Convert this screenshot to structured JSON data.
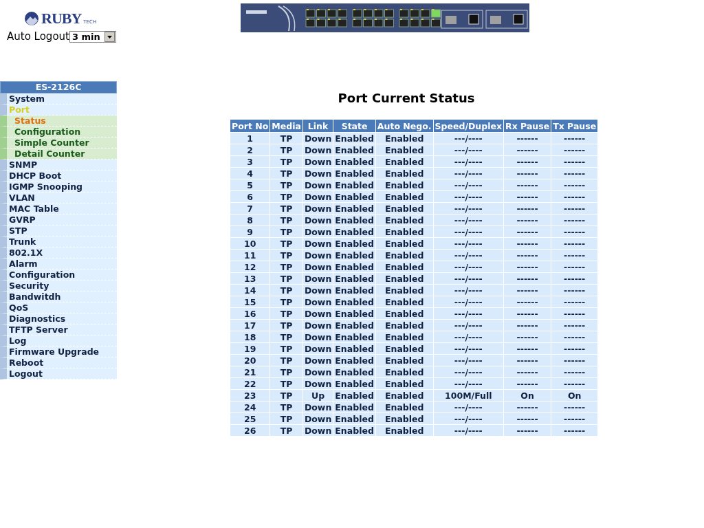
{
  "logo": {
    "text": "RUBY",
    "suffix": "TECH"
  },
  "auto_logout": {
    "label": "Auto Logout",
    "value": "3 min"
  },
  "sidebar": {
    "title": "ES-2126C",
    "items": [
      {
        "label": "System",
        "selected": false,
        "expanded": false
      },
      {
        "label": "Port",
        "selected": false,
        "expanded": true,
        "children": [
          {
            "label": "Status",
            "selected": true
          },
          {
            "label": "Configuration",
            "selected": false
          },
          {
            "label": "Simple Counter",
            "selected": false
          },
          {
            "label": "Detail Counter",
            "selected": false
          }
        ]
      },
      {
        "label": "SNMP",
        "selected": false,
        "expanded": false
      },
      {
        "label": "DHCP Boot",
        "selected": false,
        "expanded": false
      },
      {
        "label": "IGMP Snooping",
        "selected": false,
        "expanded": false
      },
      {
        "label": "VLAN",
        "selected": false,
        "expanded": false
      },
      {
        "label": "MAC Table",
        "selected": false,
        "expanded": false
      },
      {
        "label": "GVRP",
        "selected": false,
        "expanded": false
      },
      {
        "label": "STP",
        "selected": false,
        "expanded": false
      },
      {
        "label": "Trunk",
        "selected": false,
        "expanded": false
      },
      {
        "label": "802.1X",
        "selected": false,
        "expanded": false
      },
      {
        "label": "Alarm",
        "selected": false,
        "expanded": false
      },
      {
        "label": "Configuration",
        "selected": false,
        "expanded": false
      },
      {
        "label": "Security",
        "selected": false,
        "expanded": false
      },
      {
        "label": "Bandwitdh",
        "selected": false,
        "expanded": false
      },
      {
        "label": "QoS",
        "selected": false,
        "expanded": false
      },
      {
        "label": "Diagnostics",
        "selected": false,
        "expanded": false
      },
      {
        "label": "TFTP Server",
        "selected": false,
        "expanded": false
      },
      {
        "label": "Log",
        "selected": false,
        "expanded": false
      },
      {
        "label": "Firmware Upgrade",
        "selected": false,
        "expanded": false
      },
      {
        "label": "Reboot",
        "selected": false,
        "expanded": false
      },
      {
        "label": "Logout",
        "selected": false,
        "expanded": false
      }
    ]
  },
  "page_title": "Port Current Status",
  "table": {
    "columns": [
      "Port No",
      "Media",
      "Link",
      "State",
      "Auto Nego.",
      "Speed/Duplex",
      "Rx Pause",
      "Tx Pause"
    ],
    "rows": [
      [
        "1",
        "TP",
        "Down",
        "Enabled",
        "Enabled",
        "---/----",
        "------",
        "------"
      ],
      [
        "2",
        "TP",
        "Down",
        "Enabled",
        "Enabled",
        "---/----",
        "------",
        "------"
      ],
      [
        "3",
        "TP",
        "Down",
        "Enabled",
        "Enabled",
        "---/----",
        "------",
        "------"
      ],
      [
        "4",
        "TP",
        "Down",
        "Enabled",
        "Enabled",
        "---/----",
        "------",
        "------"
      ],
      [
        "5",
        "TP",
        "Down",
        "Enabled",
        "Enabled",
        "---/----",
        "------",
        "------"
      ],
      [
        "6",
        "TP",
        "Down",
        "Enabled",
        "Enabled",
        "---/----",
        "------",
        "------"
      ],
      [
        "7",
        "TP",
        "Down",
        "Enabled",
        "Enabled",
        "---/----",
        "------",
        "------"
      ],
      [
        "8",
        "TP",
        "Down",
        "Enabled",
        "Enabled",
        "---/----",
        "------",
        "------"
      ],
      [
        "9",
        "TP",
        "Down",
        "Enabled",
        "Enabled",
        "---/----",
        "------",
        "------"
      ],
      [
        "10",
        "TP",
        "Down",
        "Enabled",
        "Enabled",
        "---/----",
        "------",
        "------"
      ],
      [
        "11",
        "TP",
        "Down",
        "Enabled",
        "Enabled",
        "---/----",
        "------",
        "------"
      ],
      [
        "12",
        "TP",
        "Down",
        "Enabled",
        "Enabled",
        "---/----",
        "------",
        "------"
      ],
      [
        "13",
        "TP",
        "Down",
        "Enabled",
        "Enabled",
        "---/----",
        "------",
        "------"
      ],
      [
        "14",
        "TP",
        "Down",
        "Enabled",
        "Enabled",
        "---/----",
        "------",
        "------"
      ],
      [
        "15",
        "TP",
        "Down",
        "Enabled",
        "Enabled",
        "---/----",
        "------",
        "------"
      ],
      [
        "16",
        "TP",
        "Down",
        "Enabled",
        "Enabled",
        "---/----",
        "------",
        "------"
      ],
      [
        "17",
        "TP",
        "Down",
        "Enabled",
        "Enabled",
        "---/----",
        "------",
        "------"
      ],
      [
        "18",
        "TP",
        "Down",
        "Enabled",
        "Enabled",
        "---/----",
        "------",
        "------"
      ],
      [
        "19",
        "TP",
        "Down",
        "Enabled",
        "Enabled",
        "---/----",
        "------",
        "------"
      ],
      [
        "20",
        "TP",
        "Down",
        "Enabled",
        "Enabled",
        "---/----",
        "------",
        "------"
      ],
      [
        "21",
        "TP",
        "Down",
        "Enabled",
        "Enabled",
        "---/----",
        "------",
        "------"
      ],
      [
        "22",
        "TP",
        "Down",
        "Enabled",
        "Enabled",
        "---/----",
        "------",
        "------"
      ],
      [
        "23",
        "TP",
        "Up",
        "Enabled",
        "Enabled",
        "100M/Full",
        "On",
        "On"
      ],
      [
        "24",
        "TP",
        "Down",
        "Enabled",
        "Enabled",
        "---/----",
        "------",
        "------"
      ],
      [
        "25",
        "TP",
        "Down",
        "Enabled",
        "Enabled",
        "---/----",
        "------",
        "------"
      ],
      [
        "26",
        "TP",
        "Down",
        "Enabled",
        "Enabled",
        "---/----",
        "------",
        "------"
      ]
    ]
  }
}
